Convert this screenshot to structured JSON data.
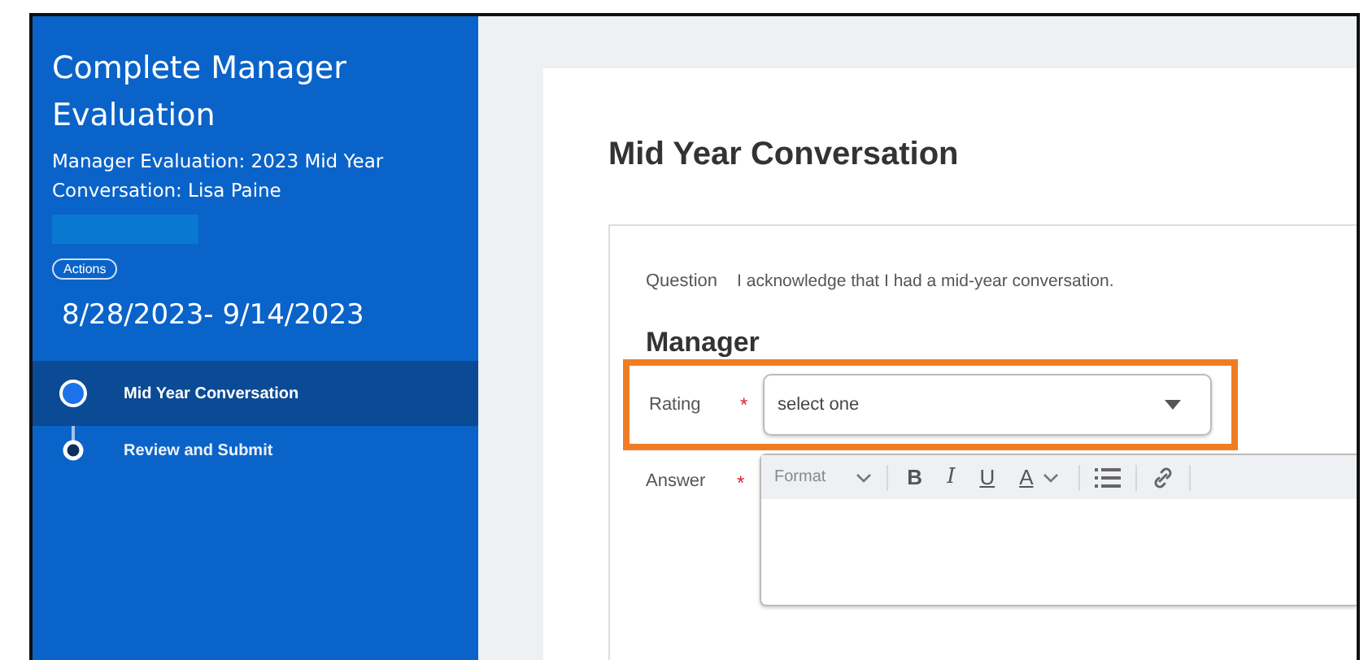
{
  "sidebar": {
    "title": "Complete Manager Evaluation",
    "subtitle": "Manager Evaluation: 2023 Mid Year Conversation: Lisa Paine",
    "actions_button": "Actions",
    "date_range": "8/28/2023- 9/14/2023",
    "steps": [
      {
        "label": "Mid Year Conversation",
        "selected": true
      },
      {
        "label": "Review and Submit",
        "selected": false
      }
    ]
  },
  "main": {
    "heading": "Mid Year Conversation",
    "question_label": "Question",
    "question_text": "I acknowledge that I had a mid-year conversation.",
    "section_title": "Manager",
    "rating": {
      "label": "Rating",
      "required_mark": "*",
      "placeholder": "select one",
      "highlighted": true
    },
    "answer": {
      "label": "Answer",
      "required_mark": "*",
      "format_dropdown": "Format",
      "toolbar_buttons": [
        {
          "kind": "bold",
          "label": "B"
        },
        {
          "kind": "italic",
          "label": "I"
        },
        {
          "kind": "underline",
          "label": "U"
        },
        {
          "kind": "color",
          "label": "A"
        }
      ]
    }
  }
}
